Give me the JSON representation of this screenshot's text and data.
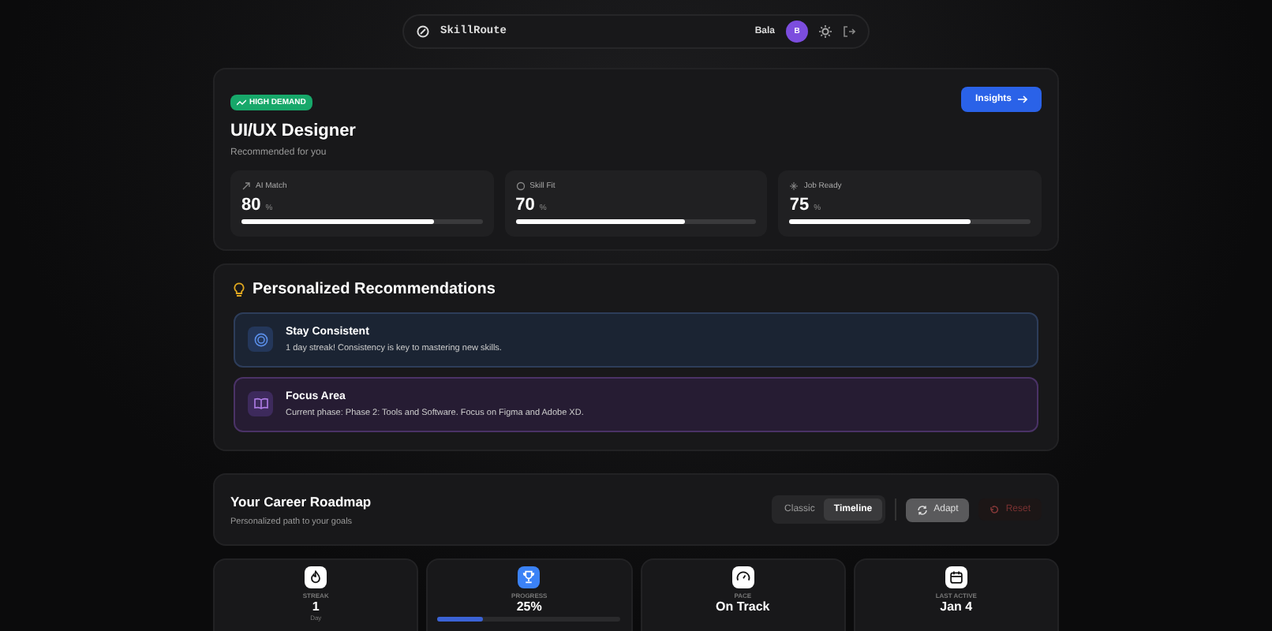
{
  "nav": {
    "brand": "SkillRoute",
    "user": "Bala",
    "avatar": "B"
  },
  "role": {
    "badge": "HIGH DEMAND",
    "title": "UI/UX Designer",
    "subtitle": "Recommended for you",
    "action": "Insights",
    "metrics": [
      {
        "kind": "match",
        "label": "AI Match",
        "value": "80",
        "unit": "%",
        "level": 0.8
      },
      {
        "kind": "fit",
        "label": "Skill Fit",
        "value": "70",
        "unit": "%",
        "level": 0.7
      },
      {
        "kind": "ready",
        "label": "Job Ready",
        "value": "75",
        "unit": "%",
        "level": 0.75
      }
    ]
  },
  "recommendations": {
    "title": "Personalized Recommendations",
    "items": [
      {
        "kind": "consistency",
        "title": "Stay Consistent",
        "text": "1 day streak! Consistency is key to mastering new skills."
      },
      {
        "kind": "focus",
        "title": "Focus Area",
        "text": "Current phase: Phase 2: Tools and Software. Focus on Figma and Adobe XD."
      }
    ]
  },
  "roadmap": {
    "title": "Your Career Roadmap",
    "subtitle": "Personalized path to your goals",
    "views": [
      {
        "label": "Classic",
        "selected": false
      },
      {
        "label": "Timeline",
        "selected": true
      }
    ],
    "actions": [
      {
        "kind": "adapt",
        "label": "Adapt"
      },
      {
        "kind": "reset",
        "label": "Reset"
      }
    ]
  },
  "stats": [
    {
      "kind": "streak",
      "label": "STREAK",
      "value": "1",
      "unit": "Day"
    },
    {
      "kind": "progress",
      "label": "PROGRESS",
      "value": "25%",
      "level": 0.25
    },
    {
      "kind": "pace",
      "label": "PACE",
      "value": "On Track"
    },
    {
      "kind": "last_active",
      "label": "LAST ACTIVE",
      "value": "Jan 4"
    }
  ]
}
